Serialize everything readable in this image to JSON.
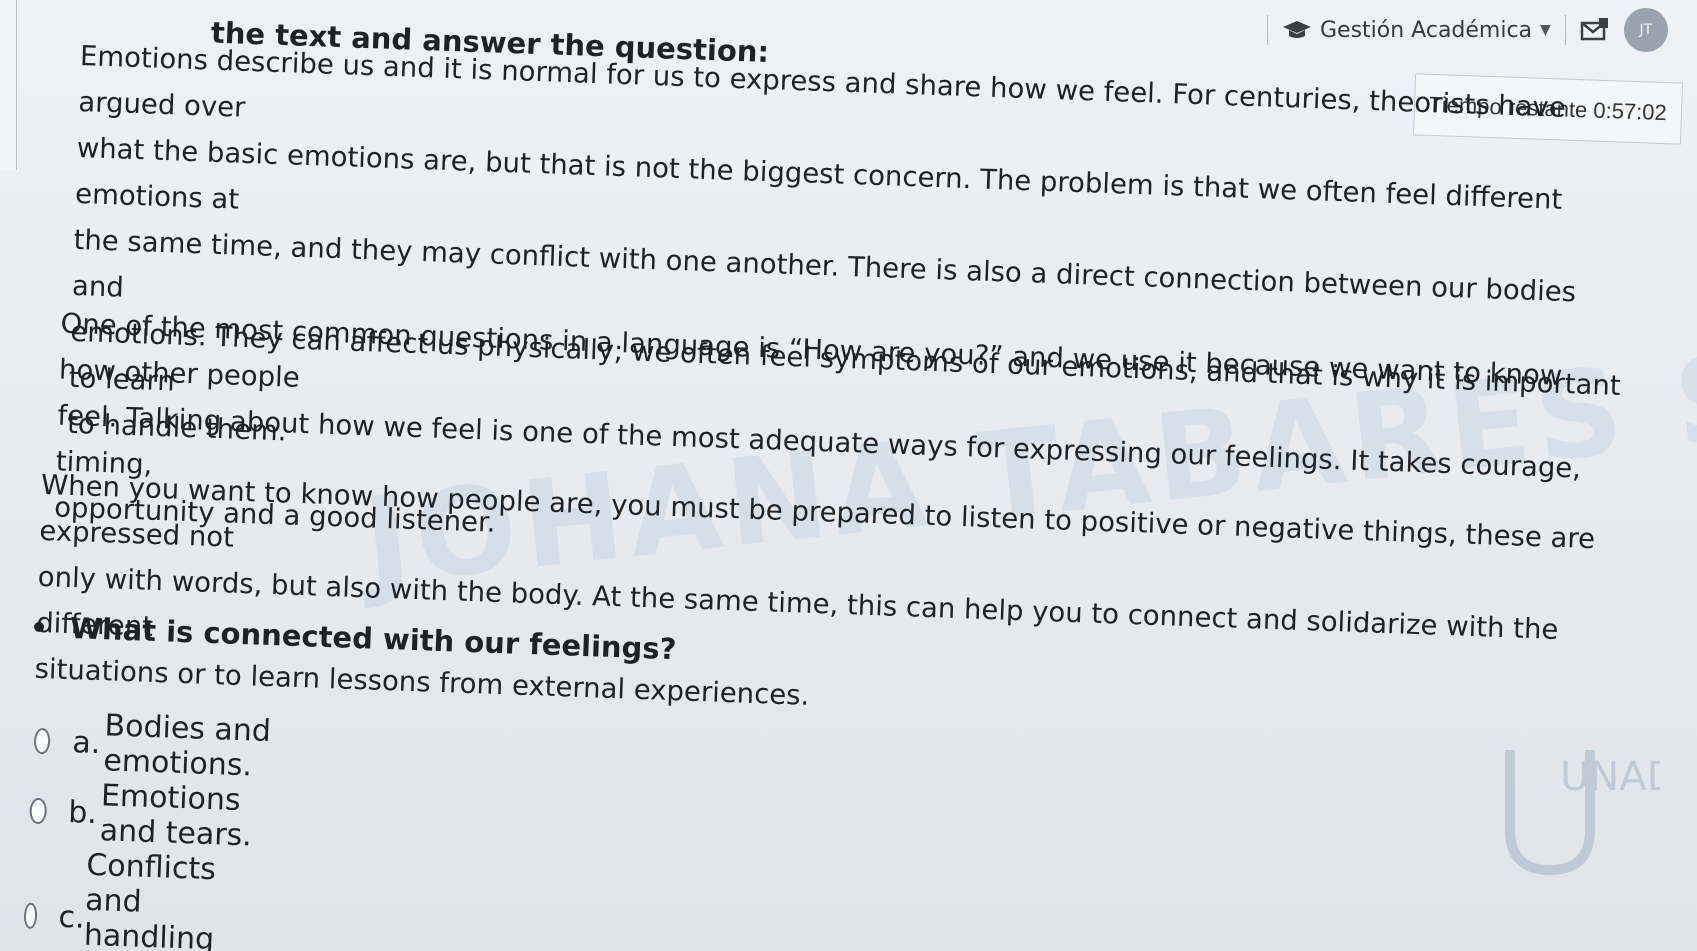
{
  "header": {
    "menu_label": "Gestión Académica",
    "avatar_initials": "JT"
  },
  "timer": {
    "label": "Tiempo restante 0:57:02"
  },
  "instruction": "the text and answer the question:",
  "paragraphs": [
    [
      "Emotions describe us and it is normal for us to express and share how we feel. For centuries, theorists have argued over",
      "what the basic emotions are, but that is not the biggest concern. The problem is that we often feel different emotions at",
      "the same time, and they may conflict with one another. There is also a direct connection between our bodies and",
      "emotions. They can affect us physically; we often feel symptoms of our emotions, and that is why it is important to learn",
      "to handle them."
    ],
    [
      "One of the most common questions in a language is “How are you?” and we use it because we want to know how other people",
      "feel. Talking about how we feel is one of the most adequate ways for expressing our feelings. It takes courage, timing,",
      "opportunity and a good listener."
    ],
    [
      "When you want to know how people are, you must be prepared to listen to positive or negative things, these are expressed not",
      "only with words, but also with the body. At the same time, this can help you to connect and solidarize with the different",
      "situations or to learn lessons from external experiences."
    ]
  ],
  "question": "What is connected with our feelings?",
  "options": [
    {
      "letter": "a.",
      "text": "Bodies and emotions."
    },
    {
      "letter": "b.",
      "text": "Emotions and tears."
    },
    {
      "letter": "c.",
      "text": "Conflicts and handling emotions."
    }
  ],
  "watermark": "JOHANA TABARES SERNA",
  "logo_text": "UNAD"
}
